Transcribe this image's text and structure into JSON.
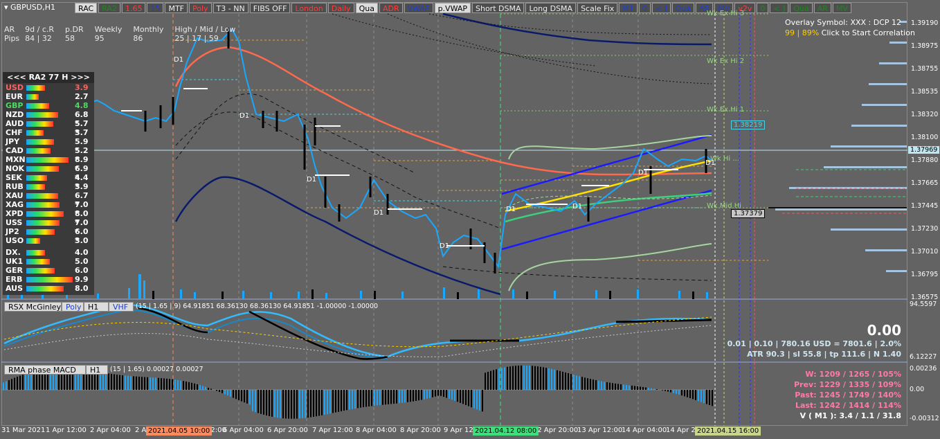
{
  "window": {
    "symbol": "GBPUSD,H1"
  },
  "toolbar": [
    {
      "label": "RAC",
      "style": "light"
    },
    {
      "label": "RA2",
      "style": "green"
    },
    {
      "label": "1.65",
      "style": "red"
    },
    {
      "label": "15",
      "style": "blue"
    },
    {
      "label": "MTF",
      "style": ""
    },
    {
      "label": "Poly",
      "style": "red"
    },
    {
      "label": "T3 - NN",
      "style": ""
    },
    {
      "label": "FIBS OFF",
      "style": ""
    },
    {
      "label": "London",
      "style": "red"
    },
    {
      "label": "Daily",
      "style": "red"
    },
    {
      "label": "Qua",
      "style": "light"
    },
    {
      "label": "ADR",
      "style": "red"
    },
    {
      "label": "VWAP",
      "style": "blue"
    },
    {
      "label": "p.VWAP",
      "style": "light"
    },
    {
      "label": "Short DSMA",
      "style": ""
    },
    {
      "label": "Long DSMA",
      "style": ""
    },
    {
      "label": "Scale Fix",
      "style": ""
    },
    {
      "label": "M1",
      "style": "blue"
    },
    {
      "label": "0",
      "style": "blue"
    },
    {
      "label": "< ]",
      "style": "blue"
    },
    {
      "label": "Qua",
      "style": "blue"
    },
    {
      "label": "AR",
      "style": "blue"
    },
    {
      "label": "MV",
      "style": "blue"
    },
    {
      "label": "v2v",
      "style": "red"
    },
    {
      "label": "0",
      "style": "green"
    },
    {
      "label": "< ]",
      "style": "green"
    },
    {
      "label": "Qua",
      "style": "green"
    },
    {
      "label": "AR",
      "style": "green"
    },
    {
      "label": "MV",
      "style": "green"
    }
  ],
  "stats": {
    "headers": [
      "AR",
      "9d / c.R",
      "p.DR",
      "Weekly",
      "Monthly",
      "High / Mid / Low"
    ],
    "row_label": "Pips",
    "values": [
      "84 | 32",
      "58",
      "95",
      "86",
      "25 | 17 | 59"
    ]
  },
  "currency_panel": {
    "header": "<<<   RA2  77  H   >>>",
    "rows": [
      {
        "name": "USD",
        "value": "3.9",
        "color": "#ff6060",
        "bar": 0.39
      },
      {
        "name": "EUR",
        "value": "2.7",
        "color": "#ffffff",
        "bar": 0.27
      },
      {
        "name": "GBP",
        "value": "4.8",
        "color": "#4cd964",
        "bar": 0.48
      },
      {
        "name": "NZD",
        "value": "6.8 *",
        "color": "#ffffff",
        "bar": 0.68
      },
      {
        "name": "AUD",
        "value": "5.7 *",
        "color": "#ffffff",
        "bar": 0.57
      },
      {
        "name": "CHF",
        "value": "3.7",
        "color": "#ffffff",
        "bar": 0.37
      },
      {
        "name": "JPY",
        "value": "5.9 *",
        "color": "#ffffff",
        "bar": 0.59
      },
      {
        "name": "CAD",
        "value": "5.2 *",
        "color": "#ffffff",
        "bar": 0.52
      },
      {
        "name": "MXN",
        "value": "8.9 *",
        "color": "#ffffff",
        "bar": 0.89
      },
      {
        "name": "NOK",
        "value": "6.9 *",
        "color": "#ffffff",
        "bar": 0.69
      },
      {
        "name": "SEK",
        "value": "4.4 *",
        "color": "#ffffff",
        "bar": 0.44
      },
      {
        "name": "RUB",
        "value": "3.9",
        "color": "#ffffff",
        "bar": 0.39
      },
      {
        "name": "XAU",
        "value": "6.7 *",
        "color": "#ffffff",
        "bar": 0.67
      },
      {
        "name": "XAG",
        "value": "7.0 *",
        "color": "#ffffff",
        "bar": 0.7
      },
      {
        "name": "XPD",
        "value": "8.0 *",
        "color": "#ffffff",
        "bar": 0.8
      },
      {
        "name": "USS",
        "value": "7.0 *",
        "color": "#ffffff",
        "bar": 0.7
      },
      {
        "name": "JP2",
        "value": "6.0 *",
        "color": "#ffffff",
        "bar": 0.6
      },
      {
        "name": "USO",
        "value": "3.0",
        "color": "#ffffff",
        "bar": 0.3
      },
      {
        "name": "DX.",
        "value": "4.0",
        "color": "#ffffff",
        "bar": 0.4
      },
      {
        "name": "UK1",
        "value": "5.0",
        "color": "#ffffff",
        "bar": 0.5
      },
      {
        "name": "GER",
        "value": "6.0",
        "color": "#ffffff",
        "bar": 0.6
      },
      {
        "name": "ERB",
        "value": "9.9",
        "color": "#ffffff",
        "bar": 0.99
      },
      {
        "name": "AUS",
        "value": "8.0",
        "color": "#ffffff",
        "bar": 0.8
      }
    ]
  },
  "overlay": {
    "line1": "Overlay Symbol: XXX : DCP 12",
    "line2a": "99 | 89%",
    "line2b": "Click to Start Correlation"
  },
  "price_axis": {
    "labels": [
      "1.39190",
      "1.38975",
      "1.38755",
      "1.38535",
      "1.38320",
      "1.38100",
      "1.37880",
      "1.37665",
      "1.37445",
      "1.37230",
      "1.37010",
      "1.36795",
      "1.36575"
    ],
    "current_price": "1.37969",
    "box_a": "1.38219",
    "box_b": "1.37379"
  },
  "level_labels": [
    "Wk Ex Hi 3",
    "Wk Ex Hi 2",
    "Wk Ex Hi 1",
    "Wk Mid Hi",
    "Wk Hi ..."
  ],
  "d1_labels": [
    "D1",
    "D1",
    "D1",
    "D1",
    "D1",
    "D1",
    "D1",
    "D1",
    "D1",
    "D1"
  ],
  "rsx": {
    "name": "RSX McGinley",
    "tab1": "Poly",
    "tab2": "H1",
    "tab3": "VHF",
    "params": "(15 | 1.65 | 9) 64.91851 68.36130 68.36130 64.91851 -1.00000 -1.00000",
    "axis_top": "94.5597",
    "axis_bottom": "6.12227",
    "big_value": "0.00",
    "line1": "0.01  |  0.10  |  780.16 USD = 7801.6  |  2.0%",
    "line2": "ATR 90.3  |  sl 55.8  |  tp 111.6  |  N 1.40"
  },
  "macd": {
    "name": "RMA phase MACD",
    "tab": "H1",
    "params": "(15 | 1.65) 0.00027 0.00027",
    "axis_top": "0.00236",
    "axis_mid": "0.00",
    "axis_bottom": "-0.00312",
    "stats": [
      "W: 1209 / 1265 / 105%",
      "Prev: 1229 / 1335 / 109%",
      "Past: 1245 / 1749 / 140%",
      "Last: 1242 / 1414 / 114%"
    ],
    "vline": "V ( M1 ): 3.4 / 1.1 / 31.8"
  },
  "time_axis": {
    "labels": [
      "31 Mar 2021",
      "1 Apr 12:00",
      "2 Apr 04:00",
      "2 Apr",
      "5 Apr 12:00",
      "6 Apr 04:00",
      "6 Apr 20:00",
      "7 Apr 12:00",
      "8 Apr 04:00",
      "8 Apr 20:00",
      "9 Apr 12:00",
      "12 Apr 20:00",
      "13 Apr 12:00",
      "14 Apr 04:00",
      "14 Apr 20:00"
    ],
    "highlight_a": "2021.04.05 10:00",
    "highlight_b": "2021.04.12 08:00",
    "highlight_c": "2021.04.15 16:00"
  },
  "colors": {
    "background": "#636363",
    "candle_up": "#19a8ff",
    "candle_down": "#000000",
    "ma_red": "#ff6a4d",
    "channel_blue": "#1a1aff",
    "rsx_blue": "#33bbff"
  }
}
